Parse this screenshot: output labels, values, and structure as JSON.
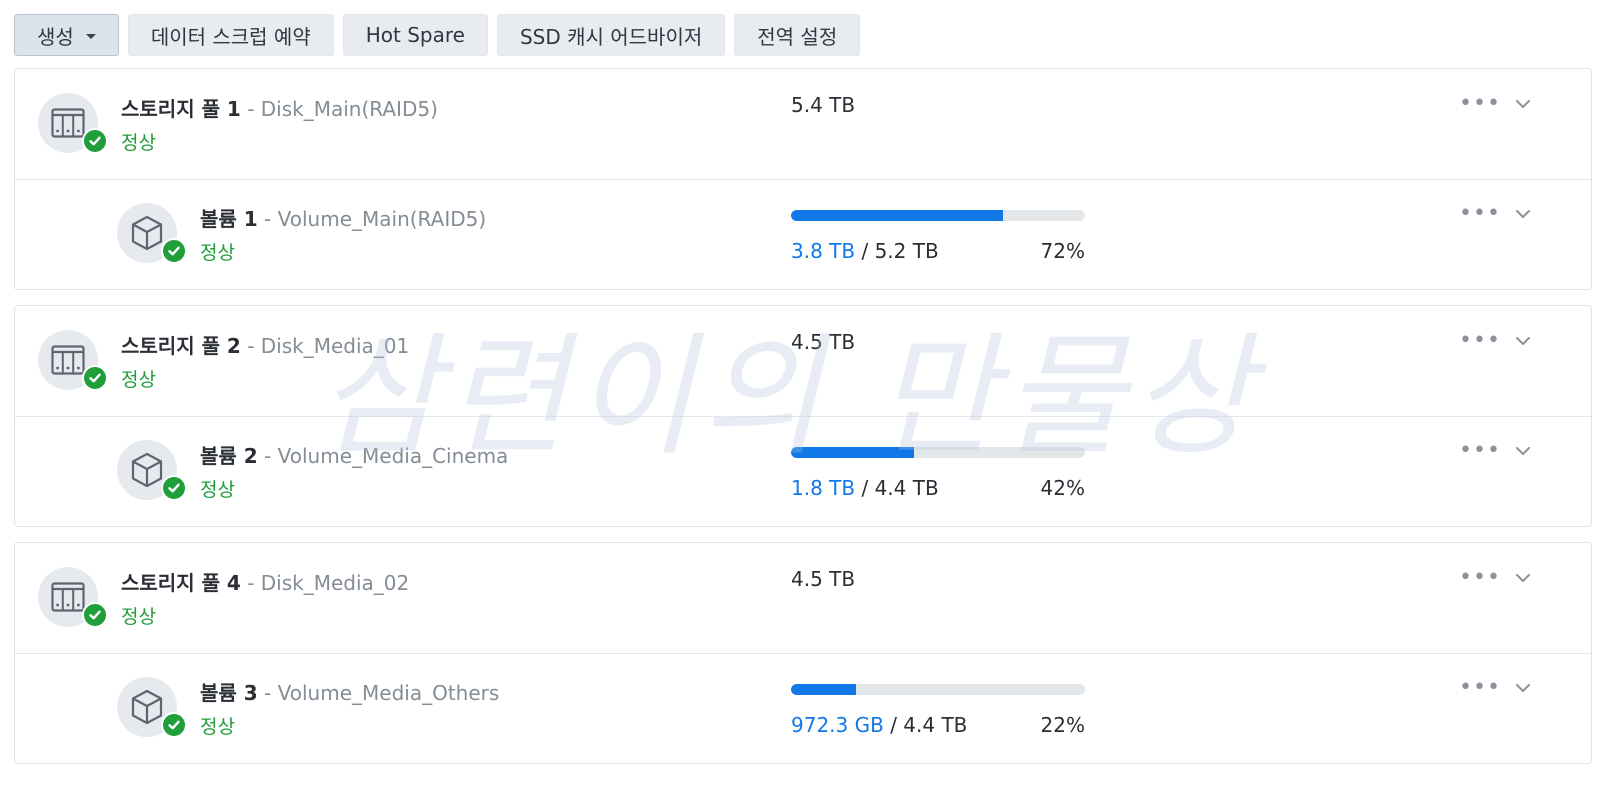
{
  "toolbar": {
    "create_label": "생성",
    "scrub_label": "데이터 스크럽 예약",
    "hotspare_label": "Hot Spare",
    "ssd_label": "SSD 캐시 어드바이저",
    "global_label": "전역 설정"
  },
  "pools": [
    {
      "name": "스토리지 풀 1",
      "desc": " - Disk_Main(RAID5)",
      "status": "정상",
      "size": "5.4 TB",
      "volume": {
        "name": "볼륨 1",
        "desc": " - Volume_Main(RAID5)",
        "status": "정상",
        "used": "3.8 TB",
        "sep": " / ",
        "total": "5.2 TB",
        "percent_label": "72%",
        "percent": 72
      }
    },
    {
      "name": "스토리지 풀 2",
      "desc": " - Disk_Media_01",
      "status": "정상",
      "size": "4.5 TB",
      "volume": {
        "name": "볼륨 2",
        "desc": " - Volume_Media_Cinema",
        "status": "정상",
        "used": "1.8 TB",
        "sep": " / ",
        "total": "4.4 TB",
        "percent_label": "42%",
        "percent": 42
      }
    },
    {
      "name": "스토리지 풀 4",
      "desc": " - Disk_Media_02",
      "status": "정상",
      "size": "4.5 TB",
      "volume": {
        "name": "볼륨 3",
        "desc": " - Volume_Media_Others",
        "status": "정상",
        "used": "972.3 GB",
        "sep": " / ",
        "total": "4.4 TB",
        "percent_label": "22%",
        "percent": 22
      }
    }
  ],
  "watermark": "삼련이의 만물상",
  "colors": {
    "accent": "#1178e8",
    "status_ok": "#1f9e3a"
  },
  "icons": {
    "pool": "storage-pool-icon",
    "volume": "volume-cube-icon",
    "status": "check-circle-icon",
    "more": "more-horizontal-icon",
    "expand": "chevron-down-icon"
  }
}
